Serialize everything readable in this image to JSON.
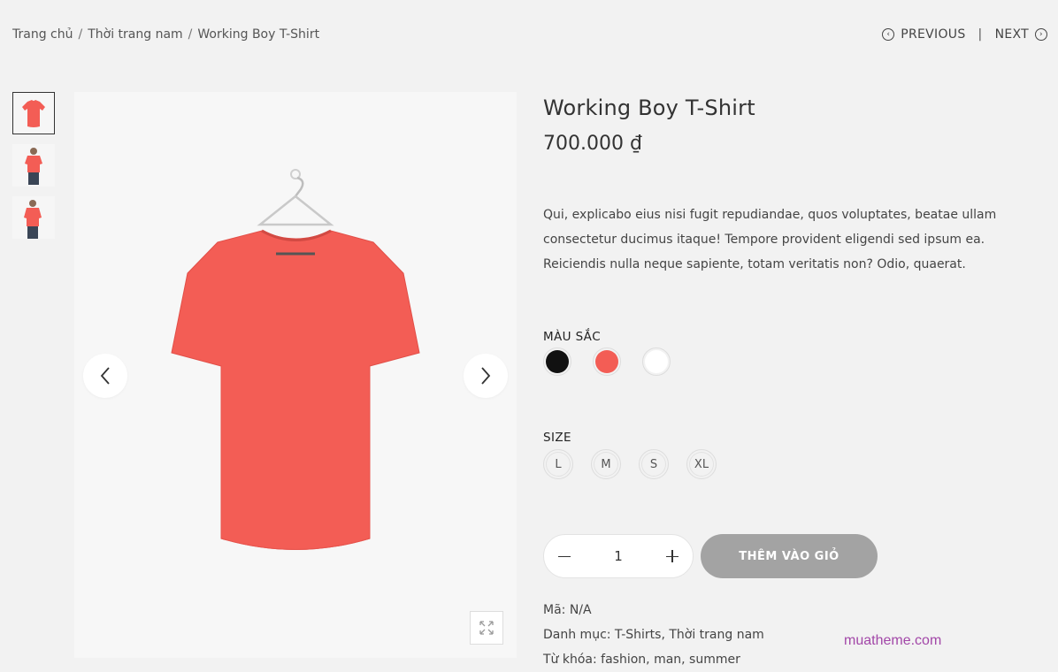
{
  "breadcrumb": {
    "home": "Trang chủ",
    "category": "Thời trang nam",
    "current": "Working Boy T-Shirt",
    "separator": "/"
  },
  "pager": {
    "previous": "PREVIOUS",
    "next": "NEXT",
    "divider": "|"
  },
  "product": {
    "title": "Working Boy T-Shirt",
    "price": "700.000 ₫",
    "description": "Qui, explicabo eius nisi fugit repudiandae, quos voluptates, beatae ullam consectetur ducimus itaque! Tempore provident eligendi sed ipsum ea. Reiciendis nulla neque sapiente, totam veritatis non? Odio, quaerat.",
    "color_label": "MÀU SẮC",
    "colors": [
      "#111111",
      "#f35d55",
      "#ffffff"
    ],
    "size_label": "SIZE",
    "sizes": [
      "L",
      "M",
      "S",
      "XL"
    ],
    "quantity": "1",
    "add_to_cart": "THÊM VÀO GIỎ",
    "meta": {
      "sku": "Mã: N/A",
      "categories": "Danh mục: T-Shirts, Thời trang nam",
      "tags": "Từ khóa: fashion, man, summer"
    }
  },
  "theme": {
    "shirt_color": "#f35d55",
    "button_color": "#a3a3a3"
  },
  "watermark": "muatheme.com"
}
